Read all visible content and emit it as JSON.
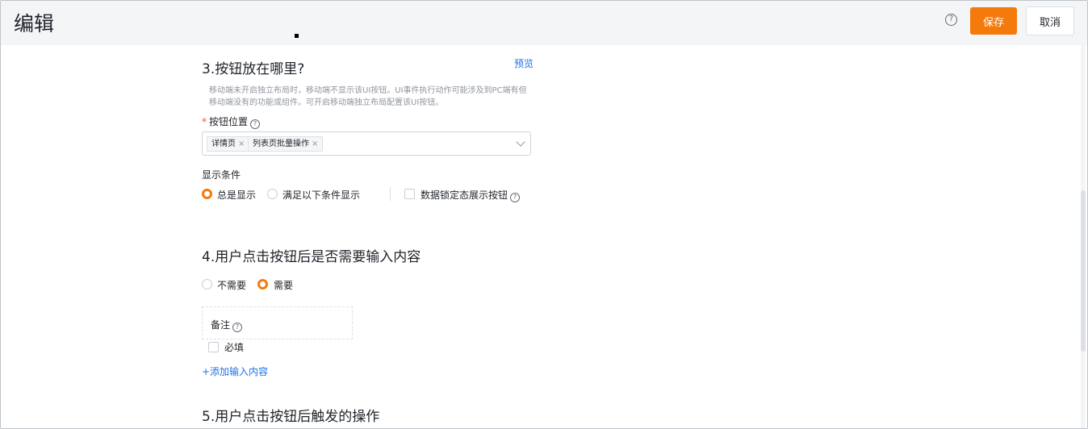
{
  "header": {
    "title": "编辑",
    "help_icon": "question-circle-icon",
    "save_label": "保存",
    "cancel_label": "取消",
    "accent_color": "#f57a0c"
  },
  "section3": {
    "title": "3.按钮放在哪里?",
    "preview_link": "预览",
    "hint": "移动端未开启独立布局时，移动端不显示该UI按钮。UI事件执行动作可能涉及到PC端有但移动端没有的功能或组件。可开启移动端独立布局配置该UI按钮。",
    "position_label": "按钮位置",
    "position_tags": [
      {
        "label": "详情页"
      },
      {
        "label": "列表页批量操作"
      }
    ],
    "display_condition_label": "显示条件",
    "radio_always": "总是显示",
    "radio_conditional": "满足以下条件显示",
    "radio_selected": "总是显示",
    "lock_checkbox_label": "数据锁定态展示按钮"
  },
  "section4": {
    "title": "4.用户点击按钮后是否需要输入内容",
    "radio_no": "不需要",
    "radio_yes": "需要",
    "radio_selected": "需要",
    "field_label": "备注",
    "required_label": "必填",
    "add_link": "+添加输入内容"
  },
  "section5": {
    "title": "5.用户点击按钮后触发的操作"
  }
}
